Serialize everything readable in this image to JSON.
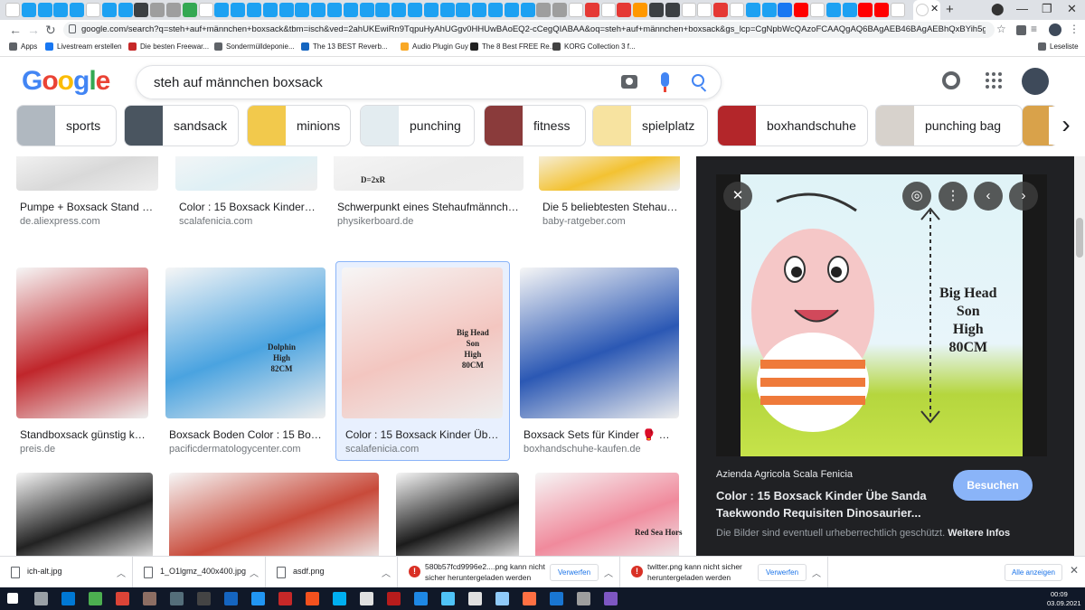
{
  "browser": {
    "url": "google.com/search?q=steh+auf+männchen+boxsack&tbm=isch&ved=2ahUKEwiRn9TqpuHyAhUGgv0HHUwBAoEQ2-cCegQIABAA&oq=steh+auf+männchen+boxsack&gs_lcp=CgNpbWcQAzoFCAAQgAQ6BAgAEB46BAgAEBhQxBYih5gkR9oAHAAeAC...",
    "new_tab": "+",
    "close_tab": "✕",
    "back": "←",
    "forward": "→",
    "reload": "↻",
    "bookmarks": [
      {
        "label": "Apps",
        "color": "#5f6368"
      },
      {
        "label": "Livestream erstellen",
        "color": "#1877f2"
      },
      {
        "label": "Die besten Freewar...",
        "color": "#c62828"
      },
      {
        "label": "Sondermülldeponie...",
        "color": "#5f6368"
      },
      {
        "label": "The 13 BEST Reverb...",
        "color": "#1565c0"
      },
      {
        "label": "Audio Plugin Guy |...",
        "color": "#f9a825"
      },
      {
        "label": "The 8 Best FREE Re...",
        "color": "#212121"
      },
      {
        "label": "KORG Collection 3 f...",
        "color": "#424242"
      }
    ],
    "reading_list": "Leseliste"
  },
  "google": {
    "logo": "Google",
    "query": "steh auf männchen boxsack",
    "chips": [
      {
        "label": "sports",
        "color": "#b0b8c0"
      },
      {
        "label": "sandsack",
        "color": "#4a5560"
      },
      {
        "label": "minions",
        "color": "#f2c94c"
      },
      {
        "label": "punching",
        "color": "#e3ecf0"
      },
      {
        "label": "fitness",
        "color": "#8a3b3b"
      },
      {
        "label": "spielplatz",
        "color": "#f7e3a0"
      },
      {
        "label": "boxhandschuhe",
        "color": "#b3262a"
      },
      {
        "label": "punching bag",
        "color": "#d7d2cc"
      }
    ]
  },
  "results": [
    {
      "title": "Pumpe + Boxsack Stand 12...",
      "source": "de.aliexpress.com",
      "color": "#d9d9d9"
    },
    {
      "title": "Color : 15 Boxsack Kinder ...",
      "source": "scalafenicia.com",
      "color": "#dff0f5"
    },
    {
      "title": "Schwerpunkt eines Stehaufmännche...",
      "source": "physikerboard.de",
      "color": "#ececec"
    },
    {
      "title": "Die 5 beliebtesten Stehauf...",
      "source": "baby-ratgeber.com",
      "color": "#f3c232"
    },
    {
      "title": "Standboxsack günstig ka...",
      "source": "preis.de",
      "color": "#c0262b"
    },
    {
      "title": "Boxsack Boden Color : 15 Boxs...",
      "source": "pacificdermatologycenter.com",
      "color": "#4aa3e0"
    },
    {
      "title": "Color : 15 Boxsack Kinder Übe ...",
      "source": "scalafenicia.com",
      "color": "#f3c6c0"
    },
    {
      "title": "Boxsack Sets für Kinder 🥊 Üb...",
      "source": "boxhandschuhe-kaufen.de",
      "color": "#2b58b4"
    },
    {
      "title": "",
      "source": "",
      "color": "#222222"
    },
    {
      "title": "",
      "source": "",
      "color": "#c84a3a"
    },
    {
      "title": "",
      "source": "",
      "color": "#1b1b1b"
    },
    {
      "title": "",
      "source": "",
      "color": "#f08a9c"
    }
  ],
  "overlay_texts": {
    "dolphin": "Dolphin\nHigh\n82CM",
    "bighead": "Big Head\nSon\nHigh\n80CM",
    "redsea": "Red Sea Hors",
    "formula": "D=2xR"
  },
  "preview": {
    "image_text": "Big Head\nSon\nHigh\n80CM",
    "site": "Azienda Agricola Scala Fenicia",
    "title": "Color : 15 Boxsack Kinder Übe Sanda Taekwondo Requisiten Dinosaurier...",
    "visit": "Besuchen",
    "copyright": "Die Bilder sind eventuell urheberrechtlich geschützt.",
    "more": "Weitere Infos"
  },
  "downloads": [
    {
      "name": "ich-alt.jpg"
    },
    {
      "name": "1_O1lgmz_400x400.jpg"
    },
    {
      "name": "asdf.png"
    },
    {
      "name": "580b57fcd9996e2....png kann nicht sicher heruntergeladen werden",
      "discard": "Verwerfen"
    },
    {
      "name": "twitter.png kann nicht sicher heruntergeladen werden",
      "discard": "Verwerfen"
    }
  ],
  "show_all": "Alle anzeigen",
  "taskbar": {
    "time": "00:09",
    "date": "03.09.2021"
  }
}
